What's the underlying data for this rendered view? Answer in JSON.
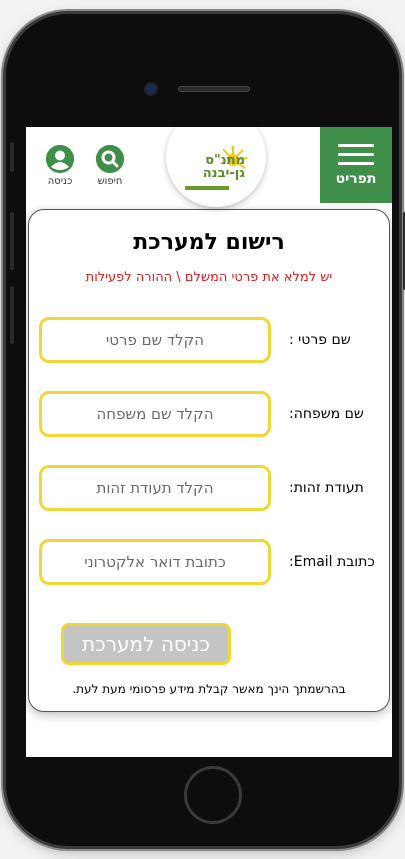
{
  "header": {
    "menu_label": "תפריט",
    "logo_text": "מתנ\"ס גן-יבנה",
    "search_label": "חיפוש",
    "login_label": "כניסה"
  },
  "form": {
    "title": "רישום למערכת",
    "subtitle": "יש למלא את פרטי המשלם \\ ההורה לפעילות",
    "fields": [
      {
        "label": "שם פרטי :",
        "placeholder": "הקלד שם פרטי"
      },
      {
        "label": "שם משפחה:",
        "placeholder": "הקלד שם משפחה"
      },
      {
        "label": "תעודת זהות:",
        "placeholder": "הקלד תעודת זהות"
      },
      {
        "label": "כתובת Email:",
        "placeholder": "כתובת דואר אלקטרוני"
      }
    ],
    "submit_label": "כניסה למערכת",
    "footnote": "בהרשמתך הינך מאשר קבלת מידע פרסומי מעת לעת."
  },
  "colors": {
    "brand_green": "#3f8f4a",
    "input_border": "#f2d635",
    "subtitle_red": "#e01818",
    "button_gray": "#c4c4c4"
  }
}
